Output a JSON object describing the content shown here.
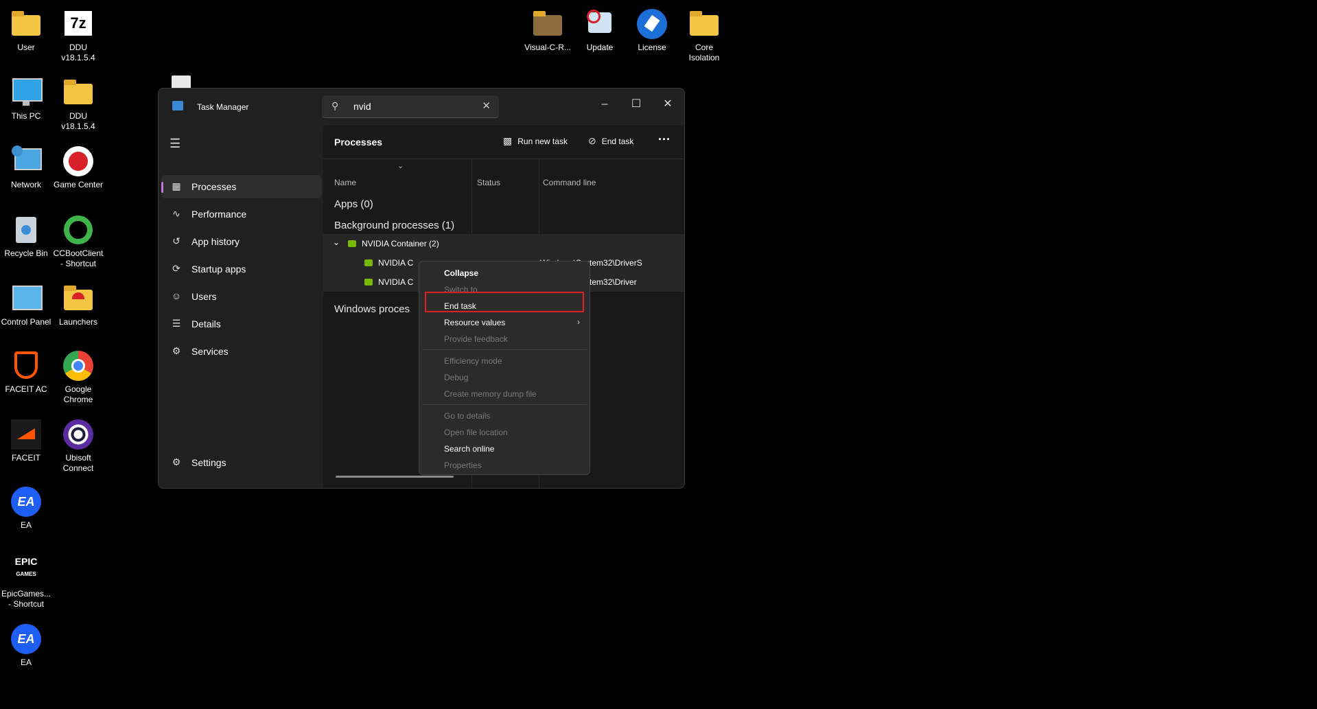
{
  "desktop": {
    "left_icons": [
      {
        "label": "User",
        "icon": "folder-icon"
      },
      {
        "label": "DDU v18.1.5.4",
        "icon": "7zip-icon"
      },
      {
        "label": "This PC",
        "icon": "monitor-icon"
      },
      {
        "label": "DDU v18.1.5.4",
        "icon": "folder-icon"
      },
      {
        "label": "Network",
        "icon": "network-icon"
      },
      {
        "label": "Game Center",
        "icon": "game-center-icon"
      },
      {
        "label": "Recycle Bin",
        "icon": "recycle-bin-icon"
      },
      {
        "label": "CCBootClient\n- Shortcut",
        "icon": "ccboot-icon"
      },
      {
        "label": "Control Panel",
        "icon": "control-panel-icon"
      },
      {
        "label": "Launchers",
        "icon": "folder-icon"
      },
      {
        "label": "FACEIT AC",
        "icon": "faceit-ac-icon"
      },
      {
        "label": "Google\nChrome",
        "icon": "chrome-icon"
      },
      {
        "label": "FACEIT",
        "icon": "faceit-icon"
      },
      {
        "label": "Ubisoft\nConnect",
        "icon": "ubisoft-icon"
      },
      {
        "label": "EA",
        "icon": "ea-icon"
      },
      {
        "label": "EpicGames...\n- Shortcut",
        "icon": "epic-games-icon"
      },
      {
        "label": "EA",
        "icon": "ea-icon"
      }
    ],
    "top_icons": [
      {
        "label": "Visual-C-R...",
        "icon": "folder-icon"
      },
      {
        "label": "Update",
        "icon": "update-icon"
      },
      {
        "label": "License",
        "icon": "license-icon"
      },
      {
        "label": "Core\nIsolation",
        "icon": "folder-icon"
      }
    ]
  },
  "window": {
    "title": "Task Manager",
    "search_value": "nvid"
  },
  "sidebar": {
    "items": [
      {
        "label": "Processes",
        "icon": "processes-icon",
        "active": true
      },
      {
        "label": "Performance",
        "icon": "performance-icon"
      },
      {
        "label": "App history",
        "icon": "app-history-icon"
      },
      {
        "label": "Startup apps",
        "icon": "startup-apps-icon"
      },
      {
        "label": "Users",
        "icon": "users-icon"
      },
      {
        "label": "Details",
        "icon": "details-icon"
      },
      {
        "label": "Services",
        "icon": "services-icon"
      }
    ],
    "settings_label": "Settings"
  },
  "main": {
    "title": "Processes",
    "run_new_task": "Run new task",
    "end_task": "End task",
    "more": "···",
    "columns": [
      "Name",
      "Status",
      "Command line"
    ],
    "groups": {
      "apps": "Apps (0)",
      "background": "Background processes (1)",
      "windows": "Windows proces"
    },
    "parent_row": "NVIDIA Container (2)",
    "child_rows": [
      {
        "name": "NVIDIA C",
        "cmd": "Windows\\System32\\DriverS"
      },
      {
        "name": "NVIDIA C",
        "cmd": "Windows\\System32\\Driver"
      }
    ]
  },
  "context_menu": {
    "items": [
      {
        "label": "Collapse",
        "enabled": true,
        "bold": true
      },
      {
        "label": "Switch to",
        "enabled": false
      },
      {
        "label": "End task",
        "enabled": true
      },
      {
        "label": "Resource values",
        "enabled": true
      },
      {
        "label": "Provide feedback",
        "enabled": false
      },
      {
        "label": "Efficiency mode",
        "enabled": false
      },
      {
        "label": "Debug",
        "enabled": false
      },
      {
        "label": "Create memory dump file",
        "enabled": false
      },
      {
        "label": "Go to details",
        "enabled": false
      },
      {
        "label": "Open file location",
        "enabled": false
      },
      {
        "label": "Search online",
        "enabled": true
      },
      {
        "label": "Properties",
        "enabled": false
      }
    ],
    "highlight_color": "#e02020"
  }
}
